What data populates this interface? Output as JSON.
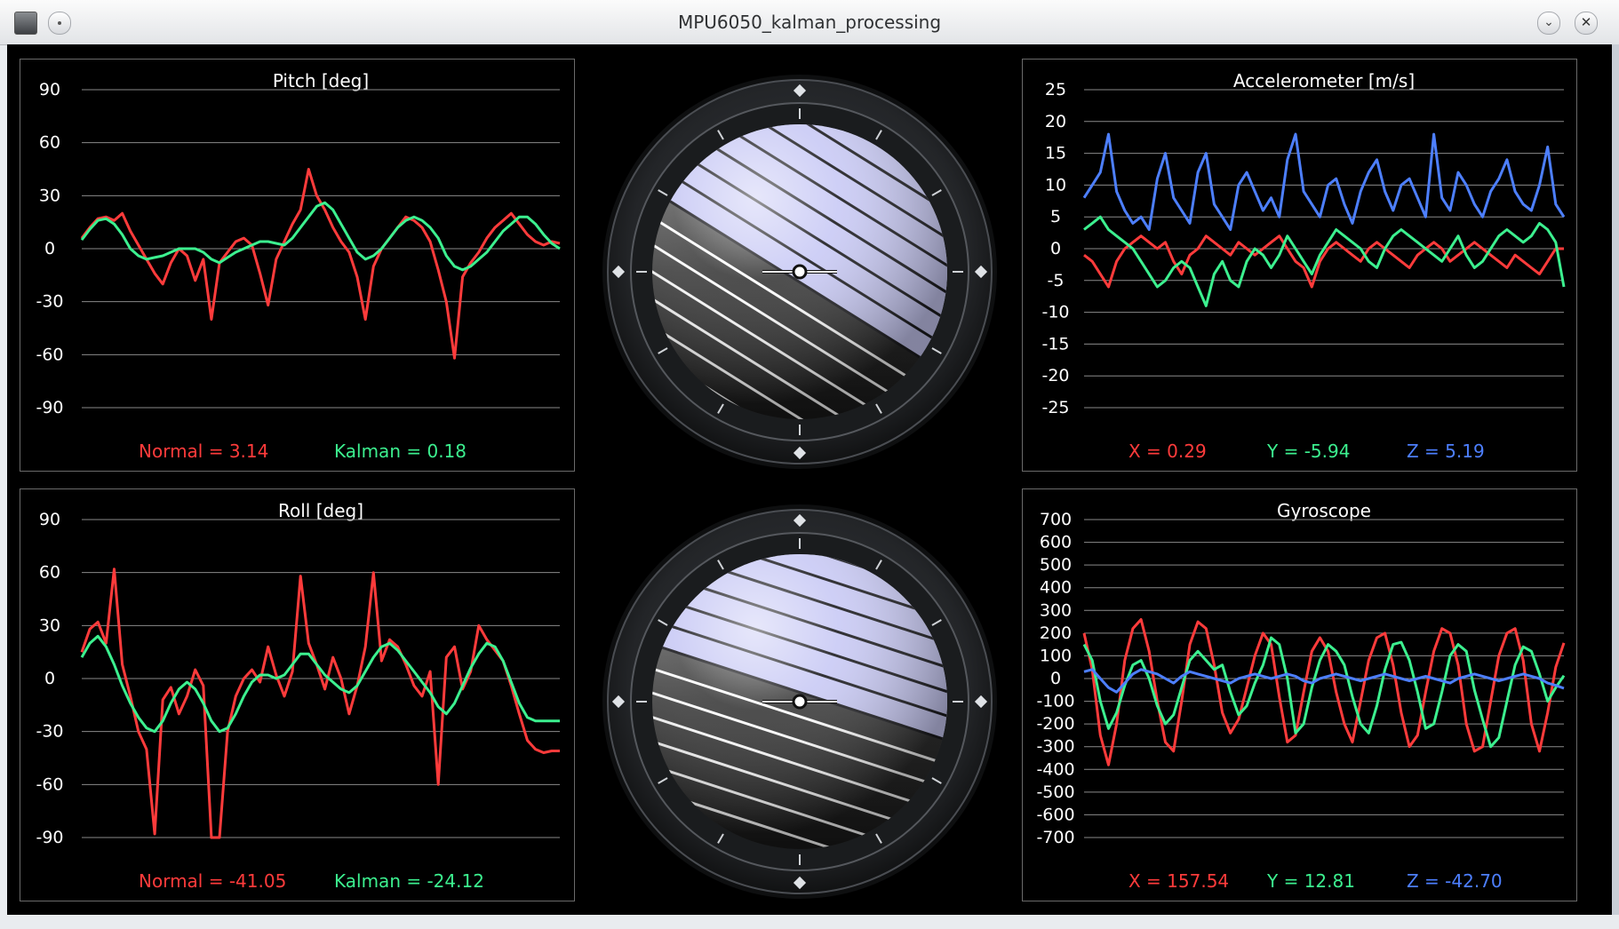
{
  "window": {
    "title": "MPU6050_kalman_processing"
  },
  "colors": {
    "red": "#ff3b3b",
    "green": "#3cf08f",
    "blue": "#4d7fff",
    "grid": "#8a8a8a",
    "text": "#ffffff"
  },
  "charts": [
    {
      "type": "line",
      "title": "Pitch [deg]",
      "ylim": [
        -90,
        90
      ],
      "yticks": [
        "90",
        "60",
        "30",
        "0",
        "-30",
        "-60",
        "-90"
      ],
      "readouts": [
        {
          "label": "Normal",
          "value": "3.14",
          "color": "#ff3b3b"
        },
        {
          "label": "Kalman",
          "value": "0.18",
          "color": "#3cf08f"
        }
      ]
    },
    {
      "type": "line",
      "title": "Accelerometer [m/s]",
      "ylim": [
        -25,
        25
      ],
      "yticks": [
        "25",
        "20",
        "15",
        "10",
        "5",
        "0",
        "-5",
        "-10",
        "-15",
        "-20",
        "-25"
      ],
      "readouts": [
        {
          "label": "X",
          "value": "0.29",
          "color": "#ff3b3b"
        },
        {
          "label": "Y",
          "value": "-5.94",
          "color": "#3cf08f"
        },
        {
          "label": "Z",
          "value": "5.19",
          "color": "#4d7fff"
        }
      ]
    },
    {
      "type": "line",
      "title": "Roll [deg]",
      "ylim": [
        -90,
        90
      ],
      "yticks": [
        "90",
        "60",
        "30",
        "0",
        "-30",
        "-60",
        "-90"
      ],
      "readouts": [
        {
          "label": "Normal",
          "value": "-41.05",
          "color": "#ff3b3b"
        },
        {
          "label": "Kalman",
          "value": "-24.12",
          "color": "#3cf08f"
        }
      ]
    },
    {
      "type": "line",
      "title": "Gyroscope",
      "ylim": [
        -700,
        700
      ],
      "yticks": [
        "700",
        "600",
        "500",
        "400",
        "300",
        "200",
        "100",
        "0",
        "-100",
        "-200",
        "-300",
        "-400",
        "-500",
        "-600",
        "-700"
      ],
      "readouts": [
        {
          "label": "X",
          "value": "157.54",
          "color": "#ff3b3b"
        },
        {
          "label": "Y",
          "value": "12.81",
          "color": "#3cf08f"
        },
        {
          "label": "Z",
          "value": "-42.70",
          "color": "#4d7fff"
        }
      ]
    }
  ],
  "chart_data": [
    {
      "type": "line",
      "title": "Pitch [deg]",
      "xlabel": "",
      "ylabel": "",
      "ylim": [
        -90,
        90
      ],
      "grid": true,
      "series": [
        {
          "name": "Normal",
          "color": "#ff3b3b",
          "values": [
            6,
            12,
            17,
            18,
            16,
            20,
            10,
            2,
            -6,
            -14,
            -20,
            -8,
            0,
            -4,
            -18,
            -6,
            -40,
            -8,
            -2,
            4,
            6,
            2,
            -14,
            -32,
            -6,
            4,
            14,
            22,
            45,
            30,
            22,
            12,
            4,
            -2,
            -16,
            -40,
            -10,
            0,
            6,
            12,
            18,
            16,
            12,
            4,
            -12,
            -30,
            -62,
            -16,
            -8,
            -2,
            6,
            12,
            16,
            20,
            14,
            8,
            4,
            2,
            4,
            3
          ]
        },
        {
          "name": "Kalman",
          "color": "#3cf08f",
          "values": [
            5,
            11,
            16,
            17,
            14,
            8,
            0,
            -4,
            -6,
            -5,
            -4,
            -2,
            0,
            0,
            0,
            -2,
            -6,
            -8,
            -5,
            -2,
            0,
            2,
            4,
            4,
            3,
            2,
            6,
            12,
            18,
            24,
            26,
            22,
            14,
            6,
            -2,
            -6,
            -4,
            0,
            6,
            12,
            16,
            18,
            16,
            12,
            6,
            -4,
            -10,
            -12,
            -10,
            -6,
            -2,
            4,
            10,
            14,
            18,
            18,
            14,
            8,
            3,
            0
          ]
        }
      ]
    },
    {
      "type": "line",
      "title": "Accelerometer [m/s]",
      "xlabel": "",
      "ylabel": "",
      "ylim": [
        -25,
        25
      ],
      "grid": true,
      "series": [
        {
          "name": "X",
          "color": "#ff3b3b",
          "values": [
            -1,
            -2,
            -4,
            -6,
            -2,
            0,
            1,
            2,
            1,
            0,
            1,
            -2,
            -4,
            -1,
            0,
            2,
            1,
            0,
            -1,
            1,
            0,
            -1,
            0,
            1,
            2,
            0,
            -2,
            -3,
            -6,
            -2,
            0,
            1,
            0,
            -1,
            -2,
            0,
            1,
            0,
            -1,
            -2,
            -3,
            -1,
            0,
            1,
            0,
            -2,
            -1,
            0,
            1,
            0,
            -1,
            -2,
            -3,
            -1,
            -2,
            -3,
            -4,
            -2,
            0,
            0
          ]
        },
        {
          "name": "Y",
          "color": "#3cf08f",
          "values": [
            3,
            4,
            5,
            3,
            2,
            1,
            0,
            -2,
            -4,
            -6,
            -5,
            -3,
            -2,
            -3,
            -6,
            -9,
            -4,
            -2,
            -5,
            -6,
            -2,
            0,
            -1,
            -3,
            -1,
            2,
            0,
            -2,
            -4,
            -1,
            1,
            3,
            2,
            1,
            0,
            -2,
            -3,
            0,
            2,
            3,
            2,
            1,
            0,
            -1,
            -2,
            0,
            2,
            -1,
            -3,
            -2,
            0,
            2,
            3,
            2,
            1,
            2,
            4,
            3,
            1,
            -6
          ]
        },
        {
          "name": "Z",
          "color": "#4d7fff",
          "values": [
            8,
            10,
            12,
            18,
            9,
            6,
            4,
            5,
            3,
            11,
            15,
            8,
            6,
            4,
            12,
            15,
            7,
            5,
            3,
            10,
            12,
            9,
            6,
            8,
            5,
            14,
            18,
            9,
            7,
            5,
            10,
            11,
            7,
            4,
            9,
            12,
            14,
            9,
            6,
            10,
            11,
            8,
            5,
            18,
            8,
            6,
            12,
            10,
            7,
            5,
            9,
            11,
            14,
            9,
            7,
            6,
            10,
            16,
            7,
            5
          ]
        }
      ]
    },
    {
      "type": "line",
      "title": "Roll [deg]",
      "xlabel": "",
      "ylabel": "",
      "ylim": [
        -90,
        90
      ],
      "grid": true,
      "series": [
        {
          "name": "Normal",
          "color": "#ff3b3b",
          "values": [
            15,
            28,
            32,
            20,
            62,
            8,
            -10,
            -30,
            -40,
            -88,
            -12,
            -5,
            -20,
            -10,
            5,
            -4,
            -90,
            -90,
            -30,
            -10,
            0,
            5,
            -2,
            18,
            2,
            -10,
            4,
            58,
            20,
            8,
            -6,
            12,
            0,
            -20,
            -4,
            18,
            60,
            10,
            22,
            18,
            8,
            -4,
            -10,
            4,
            -60,
            12,
            18,
            -6,
            4,
            30,
            22,
            16,
            10,
            -4,
            -20,
            -35,
            -40,
            -42,
            -41,
            -41
          ]
        },
        {
          "name": "Kalman",
          "color": "#3cf08f",
          "values": [
            12,
            20,
            24,
            18,
            8,
            -4,
            -14,
            -22,
            -28,
            -30,
            -24,
            -14,
            -6,
            -2,
            -6,
            -14,
            -24,
            -30,
            -28,
            -20,
            -10,
            -2,
            2,
            2,
            0,
            2,
            8,
            14,
            14,
            8,
            2,
            -2,
            -6,
            -8,
            -4,
            4,
            12,
            18,
            20,
            16,
            10,
            4,
            -2,
            -8,
            -16,
            -20,
            -14,
            -4,
            6,
            14,
            20,
            18,
            10,
            -2,
            -14,
            -22,
            -24,
            -24,
            -24,
            -24
          ]
        }
      ]
    },
    {
      "type": "line",
      "title": "Gyroscope",
      "xlabel": "",
      "ylabel": "",
      "ylim": [
        -700,
        700
      ],
      "grid": true,
      "series": [
        {
          "name": "X",
          "color": "#ff3b3b",
          "values": [
            200,
            40,
            -250,
            -380,
            -200,
            80,
            220,
            260,
            120,
            -100,
            -280,
            -320,
            -100,
            150,
            250,
            220,
            60,
            -150,
            -240,
            -180,
            -40,
            100,
            200,
            150,
            -80,
            -280,
            -250,
            -60,
            120,
            180,
            120,
            -60,
            -200,
            -280,
            -100,
            80,
            180,
            200,
            60,
            -150,
            -300,
            -250,
            -60,
            120,
            220,
            200,
            60,
            -200,
            -320,
            -300,
            -100,
            100,
            200,
            220,
            80,
            -200,
            -320,
            -150,
            50,
            157
          ]
        },
        {
          "name": "Y",
          "color": "#3cf08f",
          "values": [
            150,
            80,
            -100,
            -220,
            -150,
            -30,
            60,
            80,
            0,
            -120,
            -200,
            -160,
            -40,
            80,
            120,
            80,
            40,
            60,
            -60,
            -160,
            -120,
            -20,
            60,
            180,
            150,
            0,
            -240,
            -200,
            -40,
            80,
            150,
            120,
            60,
            -80,
            -200,
            -240,
            -120,
            40,
            150,
            160,
            80,
            -60,
            -220,
            -200,
            -60,
            100,
            150,
            120,
            -50,
            -180,
            -300,
            -260,
            -100,
            60,
            140,
            120,
            20,
            -100,
            -40,
            13
          ]
        },
        {
          "name": "Z",
          "color": "#4d7fff",
          "values": [
            30,
            40,
            0,
            -40,
            -60,
            -20,
            20,
            40,
            30,
            20,
            0,
            -20,
            10,
            30,
            20,
            10,
            0,
            -10,
            -20,
            0,
            10,
            20,
            10,
            0,
            10,
            20,
            10,
            -10,
            -20,
            0,
            10,
            20,
            10,
            0,
            -10,
            0,
            10,
            20,
            10,
            0,
            -10,
            0,
            10,
            0,
            -10,
            -20,
            0,
            10,
            20,
            10,
            0,
            -10,
            0,
            10,
            20,
            10,
            0,
            -20,
            -30,
            -43
          ]
        }
      ]
    }
  ]
}
